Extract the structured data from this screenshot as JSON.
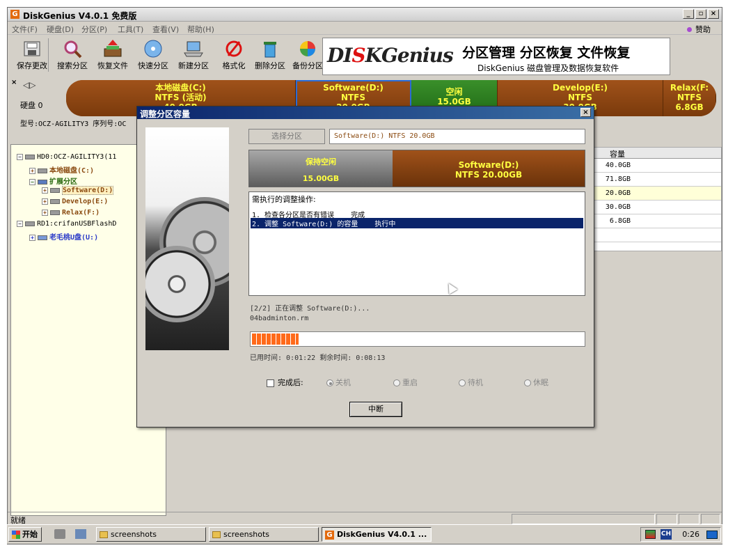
{
  "window": {
    "title": "DiskGenius V4.0.1 免费版",
    "app_icon": "G",
    "controls": [
      "_",
      "▫",
      "×"
    ]
  },
  "menu": {
    "items": [
      "文件(F)",
      "硬盘(D)",
      "分区(P)",
      "工具(T)",
      "查看(V)",
      "帮助(H)"
    ],
    "sponsor": "赞助"
  },
  "toolbar": {
    "buttons": [
      {
        "label": "保存更改",
        "icon": "save-disk-icon"
      },
      {
        "label": "搜索分区",
        "icon": "magnifier-icon"
      },
      {
        "label": "恢复文件",
        "icon": "restore-box-icon"
      },
      {
        "label": "快速分区",
        "icon": "cd-disk-icon"
      },
      {
        "label": "新建分区",
        "icon": "laptop-icon"
      },
      {
        "label": "格式化",
        "icon": "format-icon"
      },
      {
        "label": "删除分区",
        "icon": "trash-icon"
      },
      {
        "label": "备份分区",
        "icon": "backup-pie-icon"
      }
    ]
  },
  "banner": {
    "logo_left": "DI",
    "logo_red": "S",
    "logo_right": "KGenius",
    "slogan": "分区管理 分区恢复 文件恢复",
    "subtitle": "DiskGenius 磁盘管理及数据恢复软件"
  },
  "disk_map": {
    "disk_label": "硬盘 0",
    "model_line": "型号:OCZ-AGILITY3  序列号:OC",
    "partitions": [
      {
        "line1": "本地磁盘(C:)",
        "line2": "NTFS (活动)",
        "line3": "40.0GB"
      },
      {
        "line1": "Software(D:)",
        "line2": "NTFS",
        "line3": "20.0GB"
      },
      {
        "line1": "空闲",
        "line2": "15.0GB",
        "line3": ""
      },
      {
        "line1": "Develop(E:)",
        "line2": "NTFS",
        "line3": "30.0GB"
      },
      {
        "line1": "Relax(F:",
        "line2": "NTFS",
        "line3": "6.8GB"
      }
    ]
  },
  "tree": {
    "nodes": [
      {
        "text": "HD0:OCZ-AGILITY3(11",
        "pm": "−"
      },
      {
        "text": "本地磁盘(C:)",
        "pm": "+"
      },
      {
        "text": "扩展分区",
        "pm": "−"
      },
      {
        "text": "Software(D:)",
        "pm": "+"
      },
      {
        "text": "Develop(E:)",
        "pm": "+"
      },
      {
        "text": "Relax(F:)",
        "pm": "+"
      },
      {
        "text": "RD1:crifanUSBFlashD",
        "pm": "−"
      },
      {
        "text": "老毛桃U盘(U:)",
        "pm": "+"
      }
    ]
  },
  "table": {
    "header": "容量",
    "rows": [
      "40.0GB",
      "71.8GB",
      "20.0GB",
      "30.0GB",
      "6.8GB",
      "",
      ""
    ]
  },
  "dialog": {
    "title": "调整分区容量",
    "close": "×",
    "select_partition_label": "选择分区",
    "partition_info": "Software(D:) NTFS 20.0GB",
    "reserve_label": "保持空闲",
    "reserve_size": "15.00GB",
    "new_part_line1": "Software(D:)",
    "new_part_line2": "NTFS 20.00GB",
    "ops_title": "需执行的调整操作:",
    "ops": [
      "1. 检查各分区是否有错误    完成",
      "2. 调整 Software(D:) 的容量    执行中"
    ],
    "progress_line1": "[2/2] 正在调整 Software(D:)...",
    "progress_line2": "04badminton.rm",
    "progress": 0.14,
    "time_line": "已用时间:  0:01:22   剩余时间:  0:08:13",
    "after_label": "完成后:",
    "options": [
      "关机",
      "重启",
      "待机",
      "休眠"
    ],
    "abort_label": "中断"
  },
  "status": {
    "text": "就绪"
  },
  "taskbar": {
    "start": "开始",
    "tasks": [
      "screenshots",
      "screenshots",
      "DiskGenius V4.0.1 ..."
    ],
    "lang": "CH",
    "clock": "0:26"
  }
}
